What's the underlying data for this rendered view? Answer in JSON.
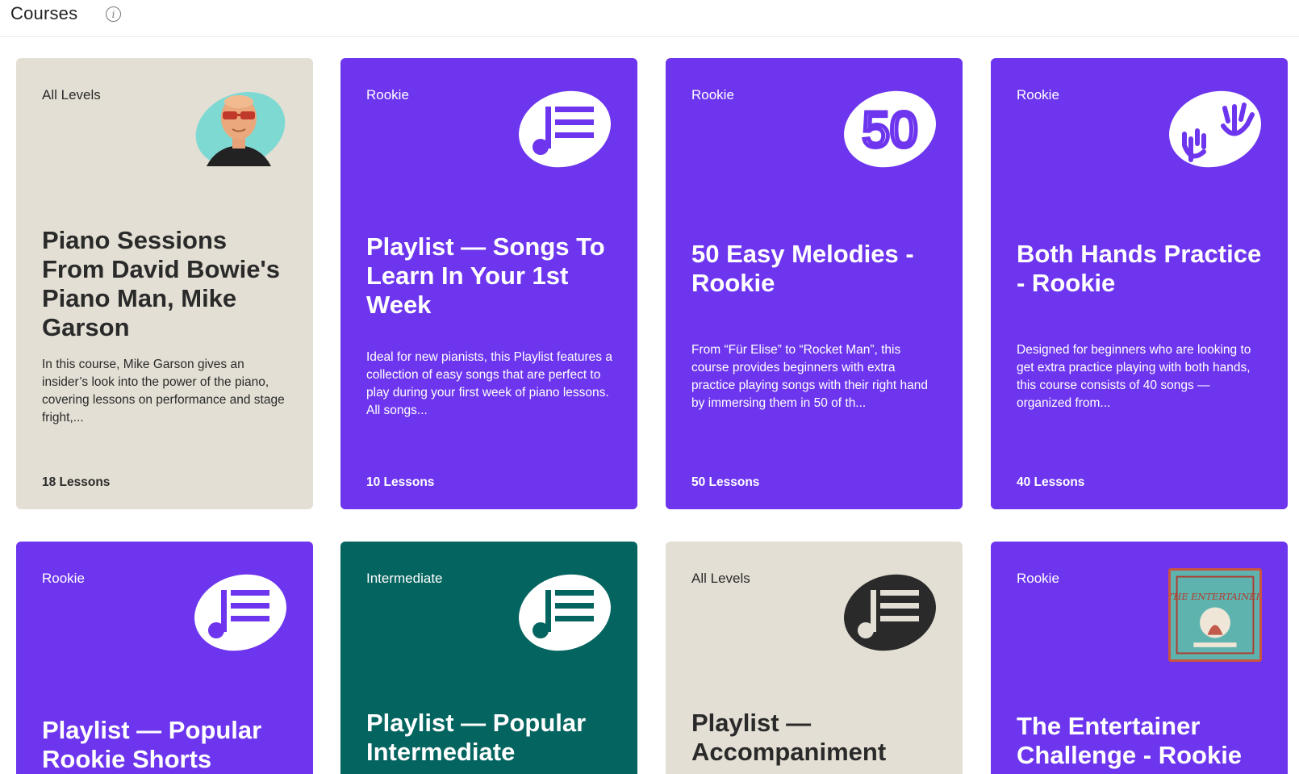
{
  "header": {
    "title": "Courses",
    "info_icon": "info-icon"
  },
  "colors": {
    "purple": "#6d35ee",
    "beige": "#e3dfd4",
    "teal": "#04645f"
  },
  "courses": [
    {
      "level": "All Levels",
      "title": "Piano Sessions From David Bowie's Piano Man, Mike Garson",
      "description": "In this course, Mike Garson gives an insider’s look into the power of the piano, covering lessons on performance and stage fright,...",
      "lessons": "18 Lessons",
      "icon": "instructor-avatar-icon",
      "color": "beige"
    },
    {
      "level": "Rookie",
      "title": "Playlist — Songs To Learn In Your 1st Week",
      "description": "Ideal for new pianists, this Playlist features a collection of easy songs that are perfect to play during your first week of piano lessons. All songs...",
      "lessons": "10 Lessons",
      "icon": "playlist-note-icon",
      "color": "purple"
    },
    {
      "level": "Rookie",
      "title": "50 Easy Melodies - Rookie",
      "description": "From “Für Elise” to “Rocket Man”, this course provides beginners with extra practice playing songs with their right hand by immersing them in 50 of th...",
      "lessons": "50 Lessons",
      "icon": "fifty-badge-icon",
      "icon_text": "50",
      "color": "purple"
    },
    {
      "level": "Rookie",
      "title": "Both Hands Practice - Rookie",
      "description": "Designed for beginners who are looking to get extra practice playing with both hands, this course consists of 40 songs — organized from...",
      "lessons": "40 Lessons",
      "icon": "both-hands-icon",
      "color": "purple"
    },
    {
      "level": "Rookie",
      "title": "Playlist — Popular Rookie Shorts",
      "icon": "playlist-note-icon",
      "color": "purple"
    },
    {
      "level": "Intermediate",
      "title": "Playlist — Popular Intermediate",
      "icon": "playlist-note-icon",
      "color": "teal"
    },
    {
      "level": "All Levels",
      "title": "Playlist — Accompaniment",
      "icon": "playlist-note-icon",
      "color": "beige"
    },
    {
      "level": "Rookie",
      "title": "The Entertainer Challenge - Rookie",
      "icon": "entertainer-sheet-thumbnail",
      "thumb_text": "THE ENTERTAINER",
      "color": "purple"
    }
  ]
}
